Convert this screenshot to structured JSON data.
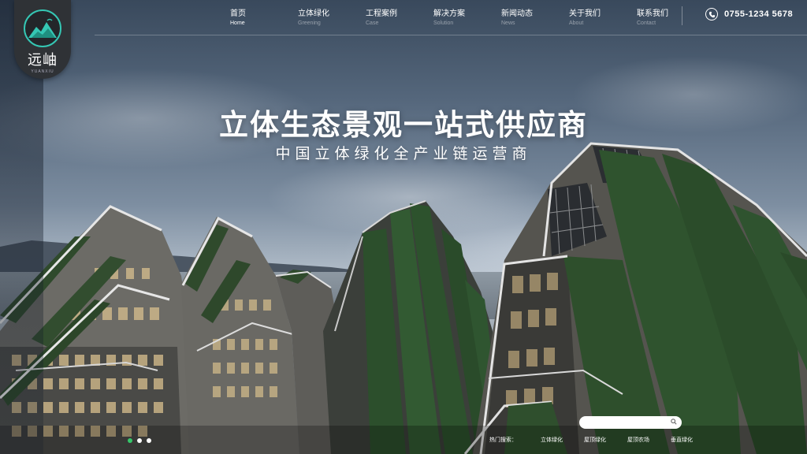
{
  "logo": {
    "name": "远岫",
    "sub": "YUANXIU"
  },
  "nav": {
    "items": [
      {
        "cn": "首页",
        "en": "Home"
      },
      {
        "cn": "立体绿化",
        "en": "Greening"
      },
      {
        "cn": "工程案例",
        "en": "Case"
      },
      {
        "cn": "解决方案",
        "en": "Solution"
      },
      {
        "cn": "新闻动态",
        "en": "News"
      },
      {
        "cn": "关于我们",
        "en": "About"
      },
      {
        "cn": "联系我们",
        "en": "Contact"
      }
    ],
    "active_index": 0,
    "phone": "0755-1234 5678"
  },
  "hero": {
    "title": "立体生态景观一站式供应商",
    "subtitle": "中国立体绿化全产业链运营商"
  },
  "search": {
    "placeholder": "",
    "hot_label": "热门搜索：",
    "hot_items": [
      "立体绿化",
      "屋顶绿化",
      "屋顶农场",
      "垂直绿化"
    ]
  },
  "slider": {
    "count": 3,
    "active": 0
  },
  "colors": {
    "accent": "#35c76a",
    "logo_ring": "#35c7b4",
    "logo_bg": "#2f3236"
  }
}
